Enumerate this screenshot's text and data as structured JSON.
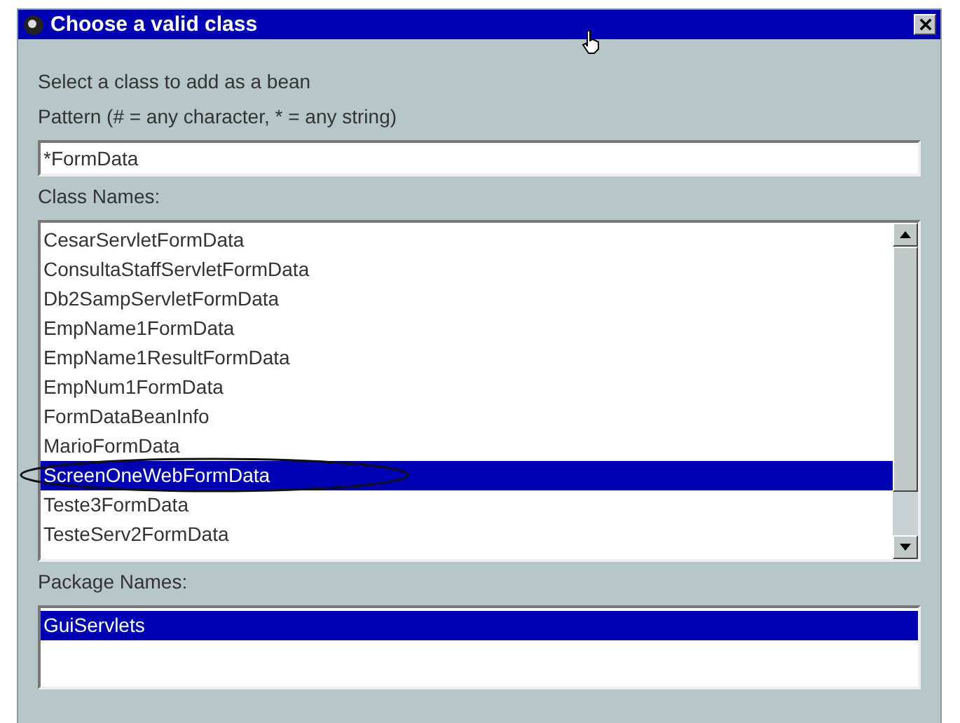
{
  "window": {
    "title": "Choose a valid class"
  },
  "prompt": "Select a class to add as a bean",
  "pattern": {
    "label": "Pattern (# = any character, * = any string)",
    "value": "*FormData"
  },
  "class_names": {
    "label": "Class Names:",
    "items": [
      {
        "text": "CesarServletFormData",
        "selected": false,
        "circled": false
      },
      {
        "text": "ConsultaStaffServletFormData",
        "selected": false,
        "circled": false
      },
      {
        "text": "Db2SampServletFormData",
        "selected": false,
        "circled": false
      },
      {
        "text": "EmpName1FormData",
        "selected": false,
        "circled": false
      },
      {
        "text": "EmpName1ResultFormData",
        "selected": false,
        "circled": false
      },
      {
        "text": "EmpNum1FormData",
        "selected": false,
        "circled": false
      },
      {
        "text": "FormDataBeanInfo",
        "selected": false,
        "circled": false
      },
      {
        "text": "MarioFormData",
        "selected": false,
        "circled": false
      },
      {
        "text": "ScreenOneWebFormData",
        "selected": true,
        "circled": true
      },
      {
        "text": "Teste3FormData",
        "selected": false,
        "circled": false
      },
      {
        "text": "TesteServ2FormData",
        "selected": false,
        "circled": false
      }
    ]
  },
  "package_names": {
    "label": "Package Names:",
    "items": [
      {
        "text": "GuiServlets",
        "selected": true
      }
    ]
  }
}
